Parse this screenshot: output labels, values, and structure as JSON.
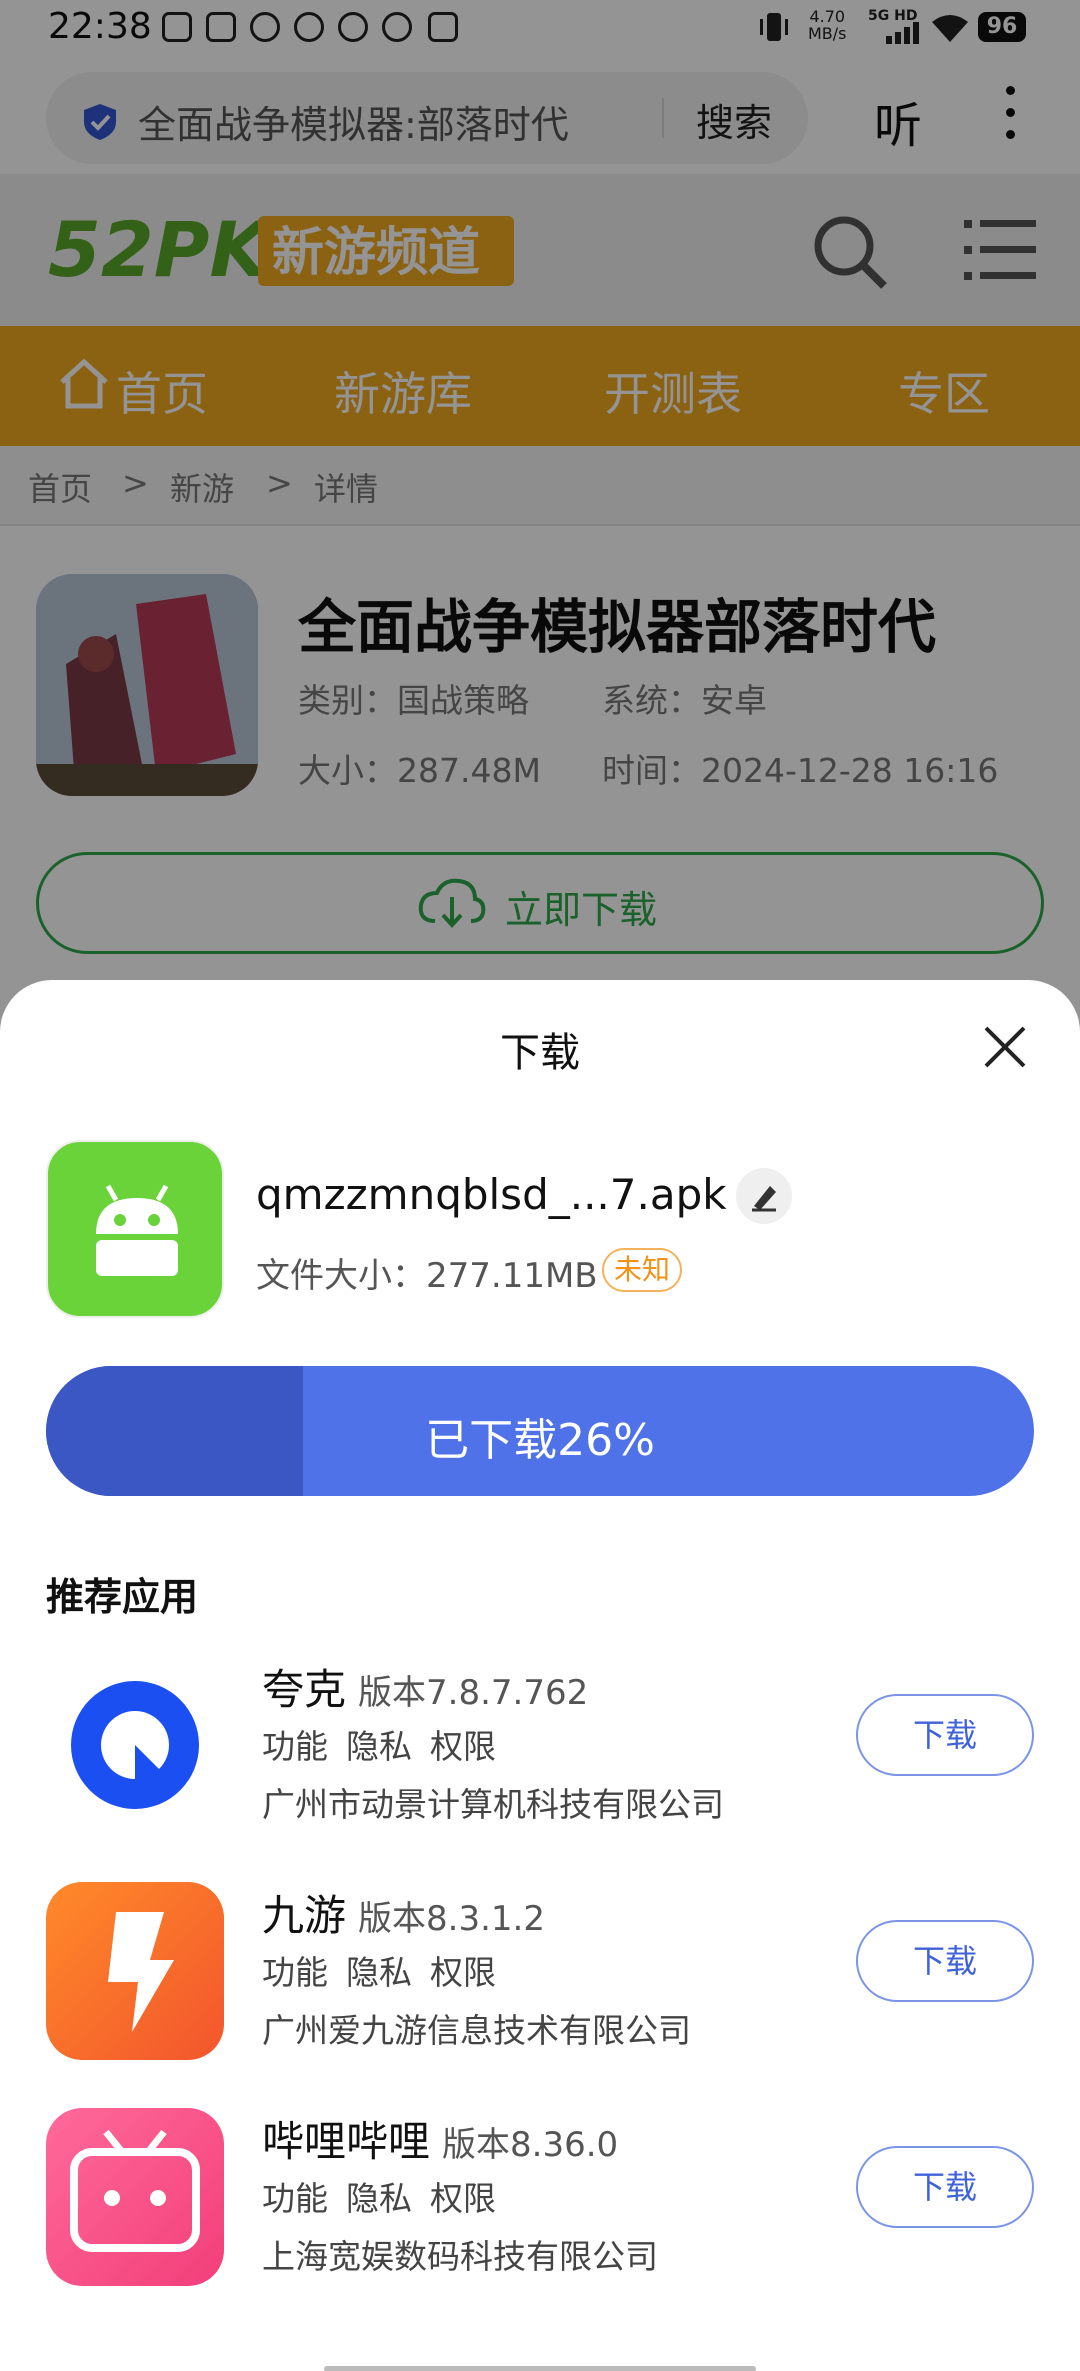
{
  "status_bar": {
    "time": "22:38",
    "net_speed": "4.70",
    "net_unit": "MB/s",
    "signal_label": "5G HD",
    "battery": "96"
  },
  "browser": {
    "url_text": "全面战争模拟器:部落时代",
    "search_label": "搜索",
    "listen_label": "听"
  },
  "site": {
    "logo_text": "52PK",
    "logo_sub": "新游频道",
    "nav": [
      "首页",
      "新游库",
      "开测表",
      "专区"
    ],
    "breadcrumb": [
      "首页",
      ">",
      "新游",
      ">",
      "详情"
    ],
    "accent": "#f0a820"
  },
  "game": {
    "title": "全面战争模拟器部落时代",
    "category": "类别：国战策略",
    "system": "系统：安卓",
    "size": "大小：287.48M",
    "time": "时间：2024-12-28 16:16",
    "download_label": "立即下载"
  },
  "sheet": {
    "title": "下载",
    "file_name": "qmzzmnqblsd_...7.apk",
    "file_size": "文件大小：277.11MB",
    "badge": "未知",
    "progress_text": "已下载26%",
    "progress": 0.26,
    "rec_title": "推荐应用",
    "apps": [
      {
        "name": "夸克",
        "version": "版本7.8.7.762",
        "links": [
          "功能",
          "隐私",
          "权限"
        ],
        "company": "广州市动景计算机科技有限公司",
        "button": "下载"
      },
      {
        "name": "九游",
        "version": "版本8.3.1.2",
        "links": [
          "功能",
          "隐私",
          "权限"
        ],
        "company": "广州爱九游信息技术有限公司",
        "button": "下载"
      },
      {
        "name": "哔哩哔哩",
        "version": "版本8.36.0",
        "links": [
          "功能",
          "隐私",
          "权限"
        ],
        "company": "上海宽娱数码科技有限公司",
        "button": "下载"
      }
    ]
  }
}
